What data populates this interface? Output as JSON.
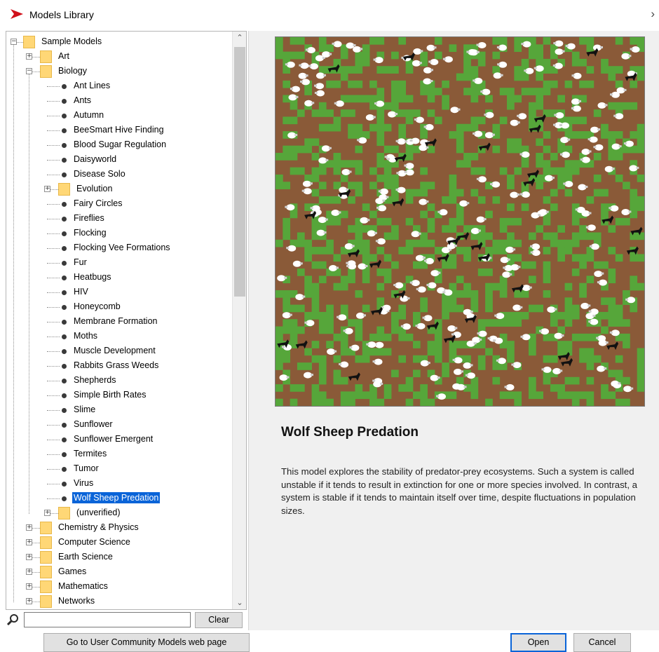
{
  "window": {
    "title": "Models Library",
    "close_symbol": "›"
  },
  "tree": {
    "rows": [
      {
        "label": "Sample Models",
        "kind": "folder",
        "level": 0,
        "expanded": true
      },
      {
        "label": "Art",
        "kind": "folder",
        "level": 1,
        "expanded": false
      },
      {
        "label": "Biology",
        "kind": "folder",
        "level": 1,
        "expanded": true
      },
      {
        "label": "Ant Lines",
        "kind": "model",
        "level": 2
      },
      {
        "label": "Ants",
        "kind": "model",
        "level": 2
      },
      {
        "label": "Autumn",
        "kind": "model",
        "level": 2
      },
      {
        "label": "BeeSmart Hive Finding",
        "kind": "model",
        "level": 2
      },
      {
        "label": "Blood Sugar Regulation",
        "kind": "model",
        "level": 2
      },
      {
        "label": "Daisyworld",
        "kind": "model",
        "level": 2
      },
      {
        "label": "Disease Solo",
        "kind": "model",
        "level": 2
      },
      {
        "label": "Evolution",
        "kind": "folder",
        "level": 2,
        "expanded": false
      },
      {
        "label": "Fairy Circles",
        "kind": "model",
        "level": 2
      },
      {
        "label": "Fireflies",
        "kind": "model",
        "level": 2
      },
      {
        "label": "Flocking",
        "kind": "model",
        "level": 2
      },
      {
        "label": "Flocking Vee Formations",
        "kind": "model",
        "level": 2
      },
      {
        "label": "Fur",
        "kind": "model",
        "level": 2
      },
      {
        "label": "Heatbugs",
        "kind": "model",
        "level": 2
      },
      {
        "label": "HIV",
        "kind": "model",
        "level": 2
      },
      {
        "label": "Honeycomb",
        "kind": "model",
        "level": 2
      },
      {
        "label": "Membrane Formation",
        "kind": "model",
        "level": 2
      },
      {
        "label": "Moths",
        "kind": "model",
        "level": 2
      },
      {
        "label": "Muscle Development",
        "kind": "model",
        "level": 2
      },
      {
        "label": "Rabbits Grass Weeds",
        "kind": "model",
        "level": 2
      },
      {
        "label": "Shepherds",
        "kind": "model",
        "level": 2
      },
      {
        "label": "Simple Birth Rates",
        "kind": "model",
        "level": 2
      },
      {
        "label": "Slime",
        "kind": "model",
        "level": 2
      },
      {
        "label": "Sunflower",
        "kind": "model",
        "level": 2
      },
      {
        "label": "Sunflower Emergent",
        "kind": "model",
        "level": 2
      },
      {
        "label": "Termites",
        "kind": "model",
        "level": 2
      },
      {
        "label": "Tumor",
        "kind": "model",
        "level": 2
      },
      {
        "label": "Virus",
        "kind": "model",
        "level": 2
      },
      {
        "label": "Wolf Sheep Predation",
        "kind": "model",
        "level": 2,
        "selected": true
      },
      {
        "label": "(unverified)",
        "kind": "folder",
        "level": 2,
        "expanded": false
      },
      {
        "label": "Chemistry & Physics",
        "kind": "folder",
        "level": 1,
        "expanded": false
      },
      {
        "label": "Computer Science",
        "kind": "folder",
        "level": 1,
        "expanded": false
      },
      {
        "label": "Earth Science",
        "kind": "folder",
        "level": 1,
        "expanded": false
      },
      {
        "label": "Games",
        "kind": "folder",
        "level": 1,
        "expanded": false
      },
      {
        "label": "Mathematics",
        "kind": "folder",
        "level": 1,
        "expanded": false
      },
      {
        "label": "Networks",
        "kind": "folder",
        "level": 1,
        "expanded": false
      }
    ]
  },
  "search": {
    "value": "",
    "clear_label": "Clear"
  },
  "buttons": {
    "community": "Go to User Community Models web page",
    "open": "Open",
    "cancel": "Cancel"
  },
  "preview": {
    "model_title": "Wolf Sheep Predation",
    "description": "This model explores the stability of predator-prey ecosystems. Such a system is called unstable if it tends to result in extinction for one or more species involved. In contrast, a system is stable if it tends to maintain itself over time, despite fluctuations in population sizes.",
    "colors": {
      "dirt": "#8a5a38",
      "grass": "#56a63a",
      "sheep": "#ffffff",
      "wolf": "#111111"
    }
  }
}
